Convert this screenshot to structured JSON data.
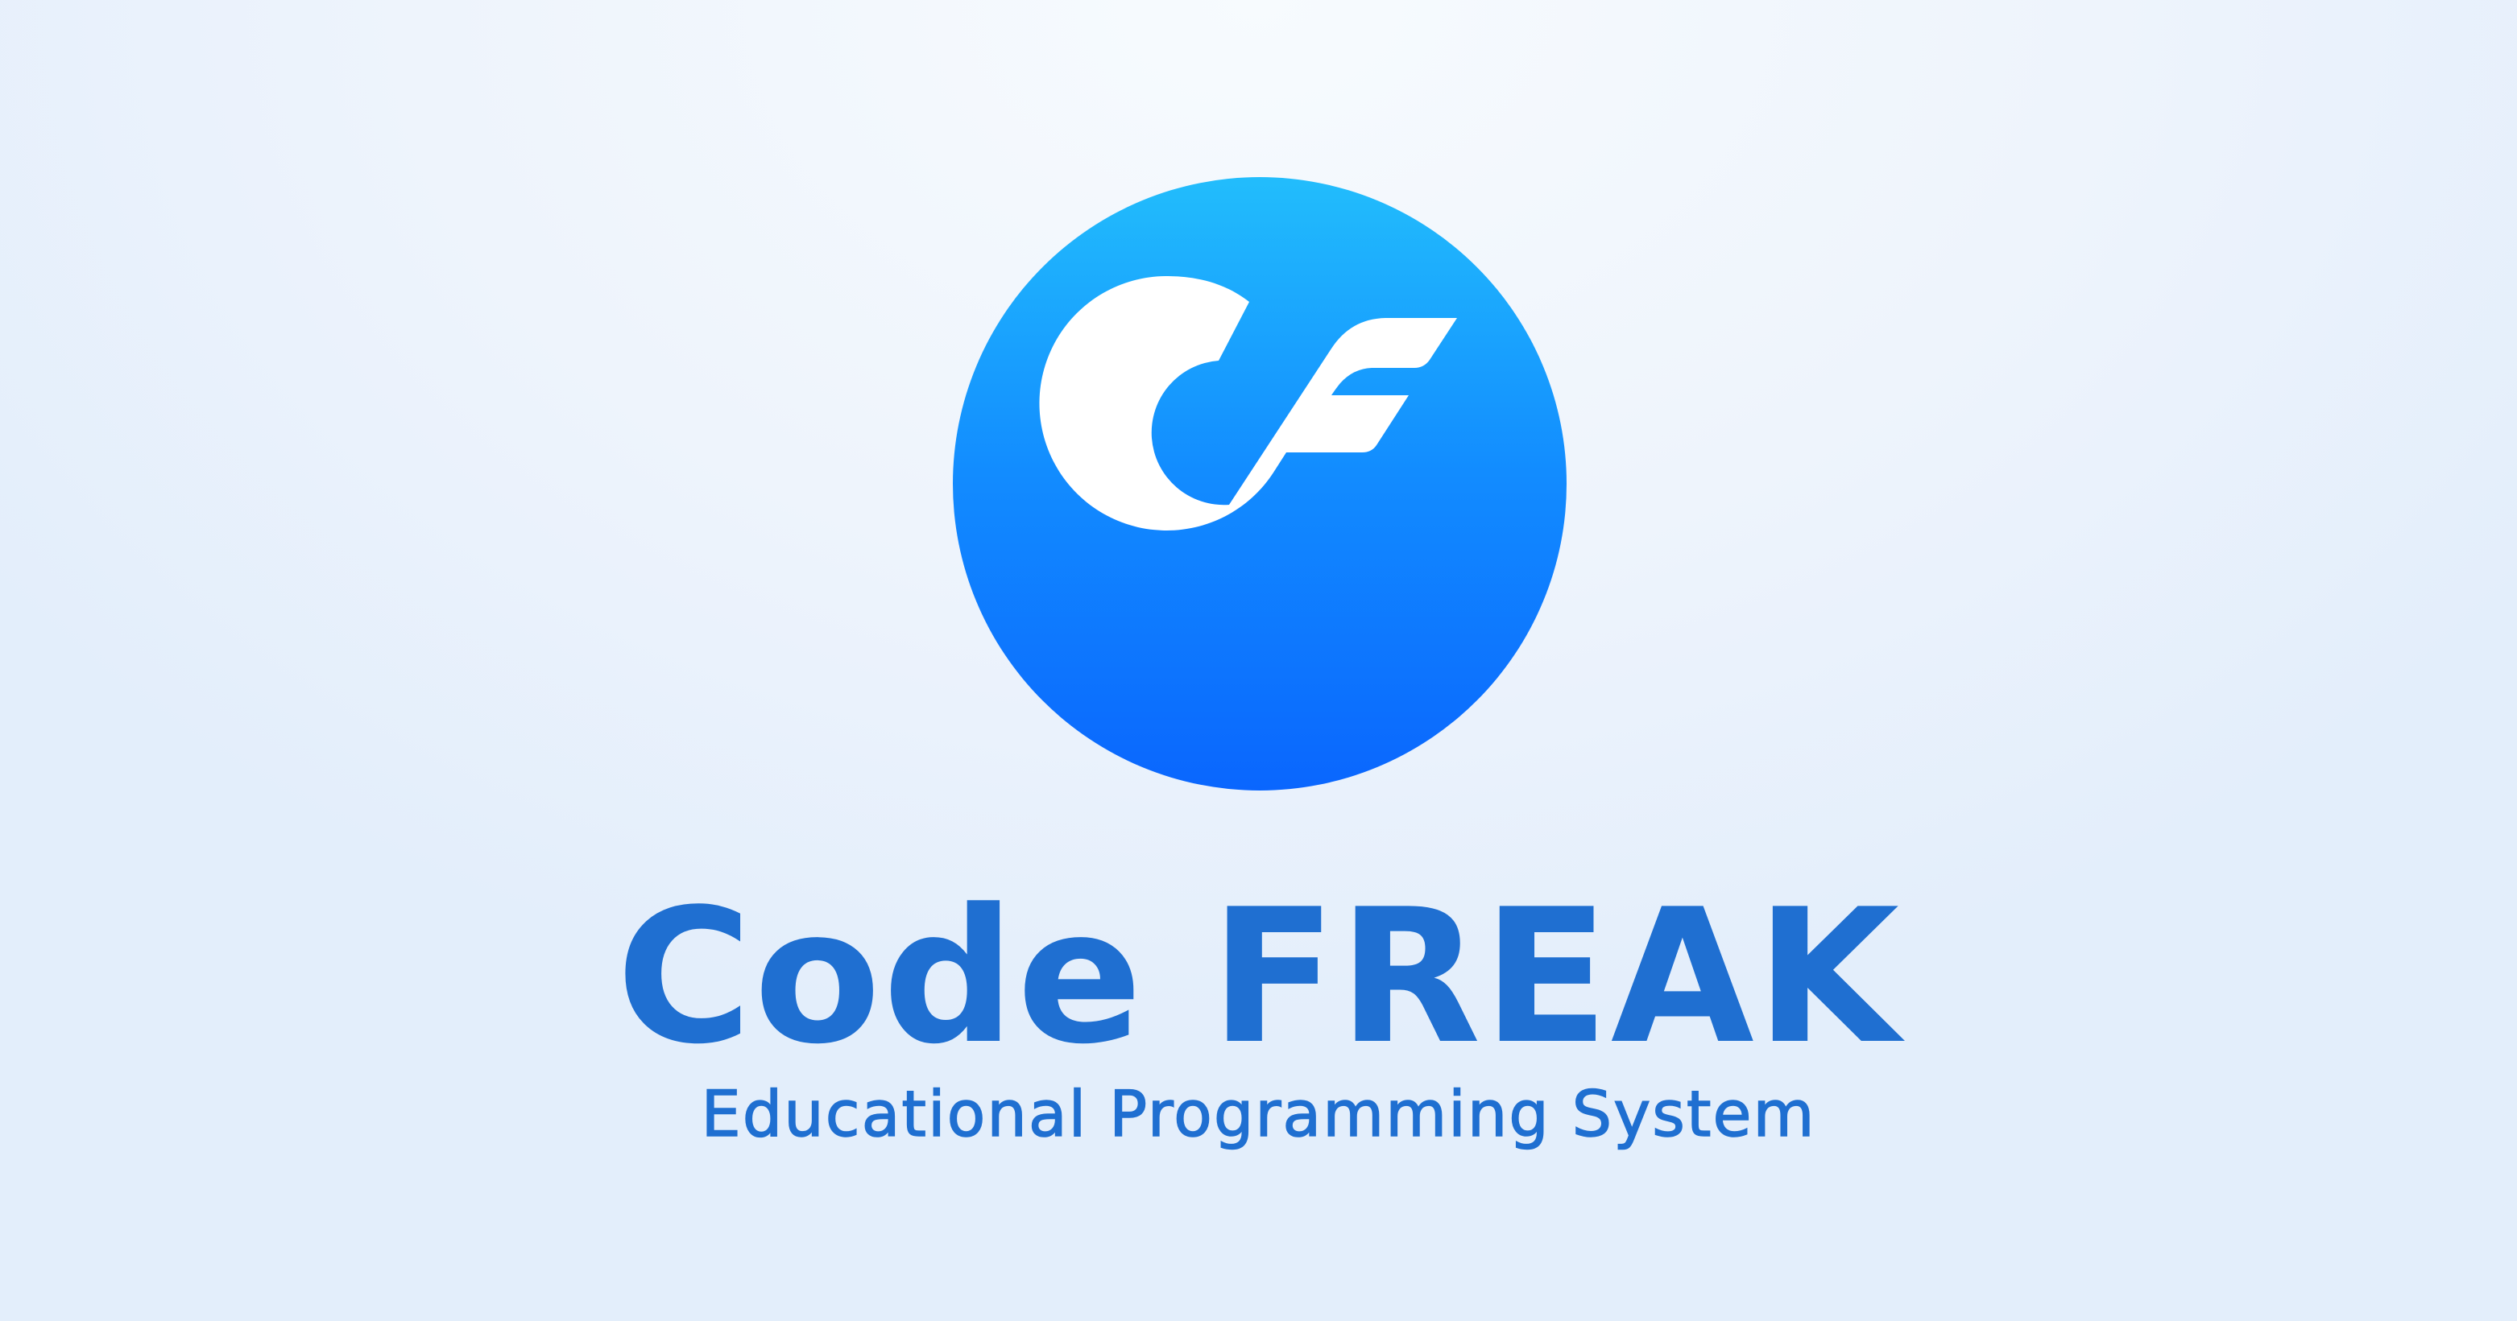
{
  "brand": {
    "name": "Code FREAK",
    "tagline": "Educational Programming System",
    "text_color": "#1f6fd1"
  },
  "logo": {
    "icon": "cf-monogram-icon",
    "gradient_top": "#22bdfc",
    "gradient_bottom": "#0a66fe",
    "glyph_color": "#ffffff"
  },
  "background": {
    "color_center": "#f7fbfe",
    "color_edge": "#e3eefb"
  }
}
